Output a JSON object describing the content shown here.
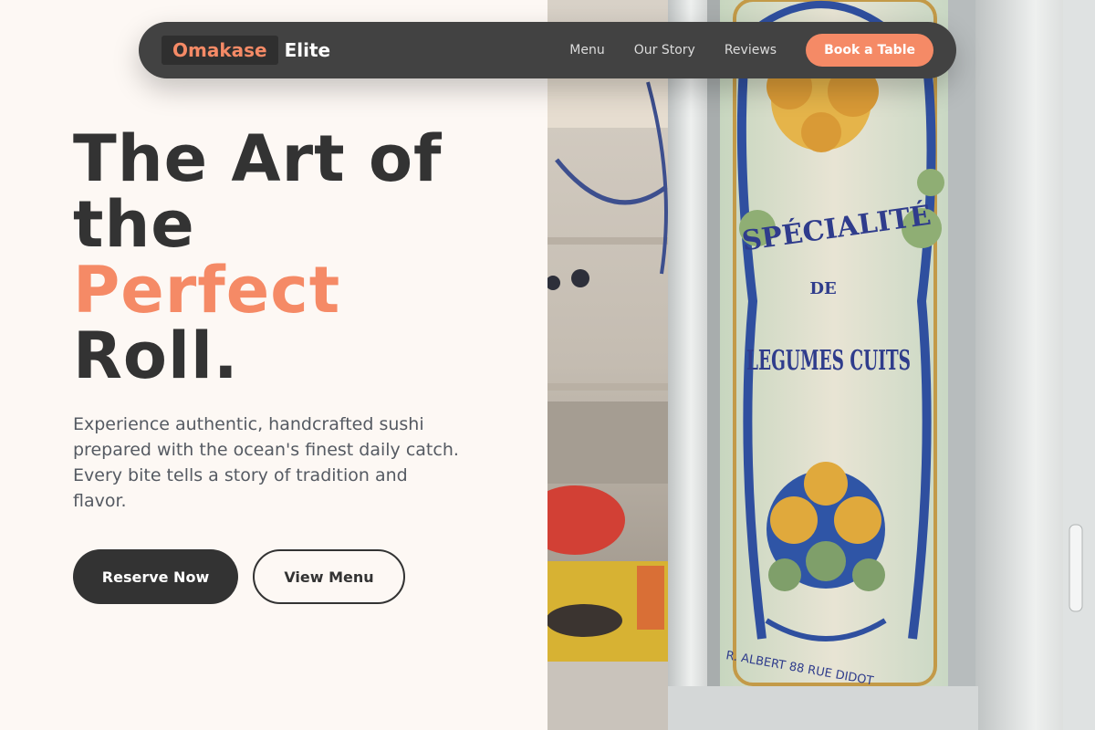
{
  "brand": {
    "name_accent": "Omakase",
    "name_rest": "Elite"
  },
  "nav": {
    "links": [
      "Menu",
      "Our Story",
      "Reviews"
    ],
    "cta_label": "Book a Table"
  },
  "hero": {
    "headline_lines": [
      "The Art of",
      "the"
    ],
    "headline_accent": "Perfect",
    "headline_end": "Roll.",
    "description": "Experience authentic, handcrafted sushi prepared with the ocean's finest daily catch. Every bite tells a story of tradition and flavor.",
    "primary_button": "Reserve Now",
    "secondary_button": "View Menu"
  },
  "photo": {
    "sign_line1": "SPÉCIALITÉ",
    "sign_line2": "DE",
    "sign_line3": "LEGUMES CUITS",
    "sign_maker": "R. ALBERT 88 RUE DIDOT"
  },
  "colors": {
    "accent": "#f58a66",
    "dark": "#333333",
    "nav_bg": "#424242",
    "page_bg": "#fdf8f4"
  }
}
